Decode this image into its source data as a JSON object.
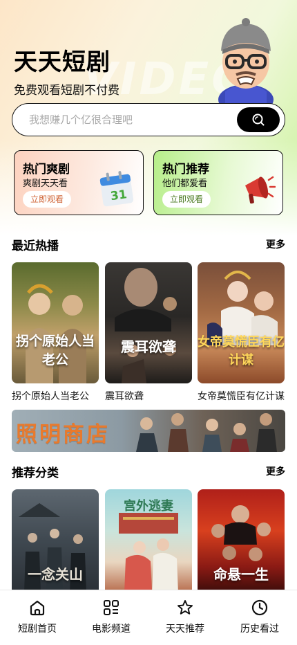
{
  "header": {
    "app_title": "天天短剧",
    "subtitle": "免费观看短剧不付费",
    "watermark": "VIDEO"
  },
  "search": {
    "placeholder": "我想赚几个亿很合理吧",
    "icon": "search-icon"
  },
  "promos": [
    {
      "title": "热门爽剧",
      "subtitle": "爽剧天天看",
      "button": "立即观看",
      "icon": "calendar-icon",
      "accent": "#d0673a"
    },
    {
      "title": "热门推荐",
      "subtitle": "他们都爱看",
      "button": "立即观看",
      "icon": "megaphone-icon",
      "accent": "#4b7a21"
    }
  ],
  "recent": {
    "title": "最近热播",
    "more": "更多",
    "items": [
      {
        "title": "拐个原始人当老公",
        "poster_text": "拐个原始人当老公"
      },
      {
        "title": "震耳欲聋",
        "poster_text": "震耳欲聋"
      },
      {
        "title": "女帝莫慌臣有亿计谋",
        "poster_text": "女帝莫慌臣有亿计谋"
      }
    ]
  },
  "banner": {
    "text": "照明商店"
  },
  "recommend": {
    "title": "推荐分类",
    "more": "更多",
    "items": [
      {
        "poster_text": "一念关山"
      },
      {
        "poster_text": "宫外逃妻"
      },
      {
        "poster_text": "命悬一生"
      }
    ]
  },
  "tabbar": {
    "items": [
      {
        "label": "短剧首页",
        "icon": "home-icon"
      },
      {
        "label": "电影频道",
        "icon": "grid-icon"
      },
      {
        "label": "天天推荐",
        "icon": "star-icon"
      },
      {
        "label": "历史看过",
        "icon": "clock-icon"
      }
    ]
  },
  "colors": {
    "accent_green": "#b6ee89",
    "accent_peach": "#fdd2bf",
    "banner_orange": "#e87a2d"
  }
}
